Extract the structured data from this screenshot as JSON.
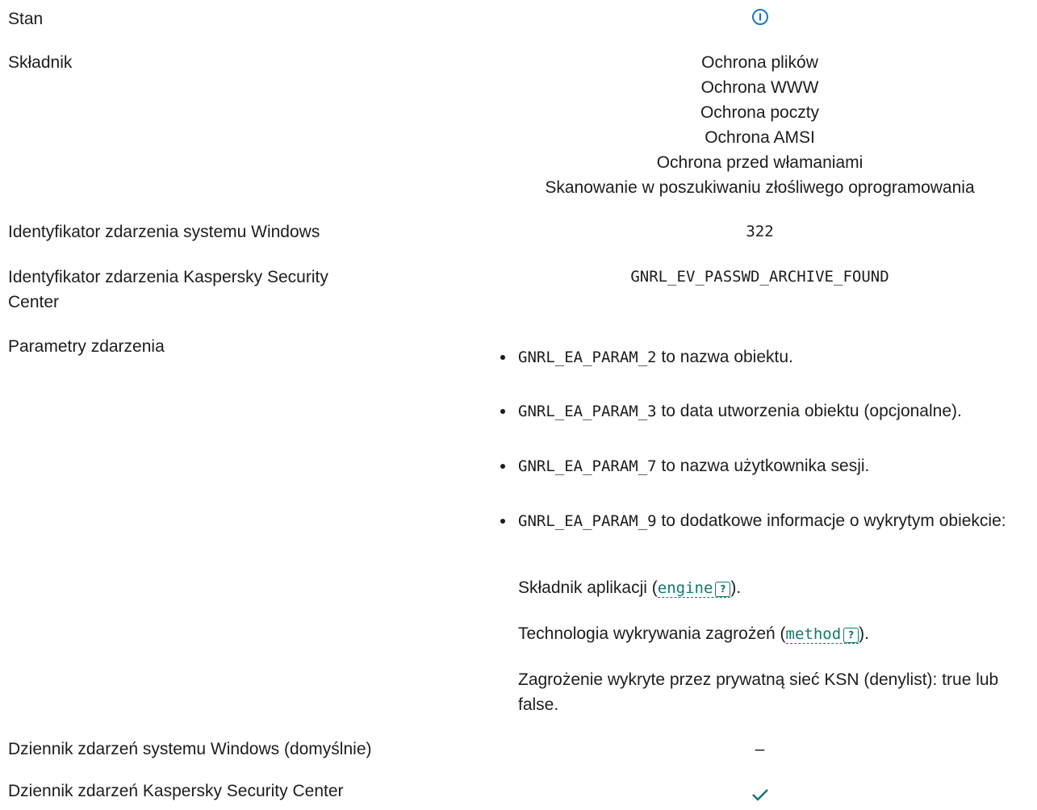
{
  "labels": {
    "stan": "Stan",
    "skladnik": "Składnik",
    "windows_id": "Identyfikator zdarzenia systemu Windows",
    "ksc_id_line1": "Identyfikator zdarzenia Kaspersky Security",
    "ksc_id_line2": "Center",
    "params": "Parametry zdarzenia",
    "windows_log": "Dziennik zdarzeń systemu Windows (domyślnie)",
    "ksc_log": "Dziennik zdarzeń Kaspersky Security Center"
  },
  "values": {
    "stan_icon": "info-icon",
    "components": [
      "Ochrona plików",
      "Ochrona WWW",
      "Ochrona poczty",
      "Ochrona AMSI",
      "Ochrona przed włamaniami",
      "Skanowanie w poszukiwaniu złośliwego oprogramowania"
    ],
    "windows_id": "322",
    "ksc_id": "GNRL_EV_PASSWD_ARCHIVE_FOUND",
    "params": [
      {
        "code": "GNRL_EA_PARAM_2",
        "text": " to nazwa obiektu."
      },
      {
        "code": "GNRL_EA_PARAM_3",
        "text": " to data utworzenia obiektu (opcjonalne)."
      },
      {
        "code": "GNRL_EA_PARAM_7",
        "text": " to nazwa użytkownika sesji."
      },
      {
        "code": "GNRL_EA_PARAM_9",
        "text": " to dodatkowe informacje o wykrytym obiekcie:"
      }
    ],
    "sub_engine_prefix": "Składnik aplikacji (",
    "sub_engine_link": "engine",
    "sub_engine_suffix": ").",
    "sub_method_prefix": "Technologia wykrywania zagrożeń (",
    "sub_method_link": "method",
    "sub_method_suffix": ").",
    "sub_ksn": "Zagrożenie wykryte przez prywatną sieć KSN (denylist): true lub false.",
    "help_glyph": "?",
    "windows_log": "–",
    "ksc_log_icon": "checkmark-icon"
  },
  "colors": {
    "accent": "#0f7a72",
    "info": "#1e74c6",
    "check": "#0f7a72"
  }
}
